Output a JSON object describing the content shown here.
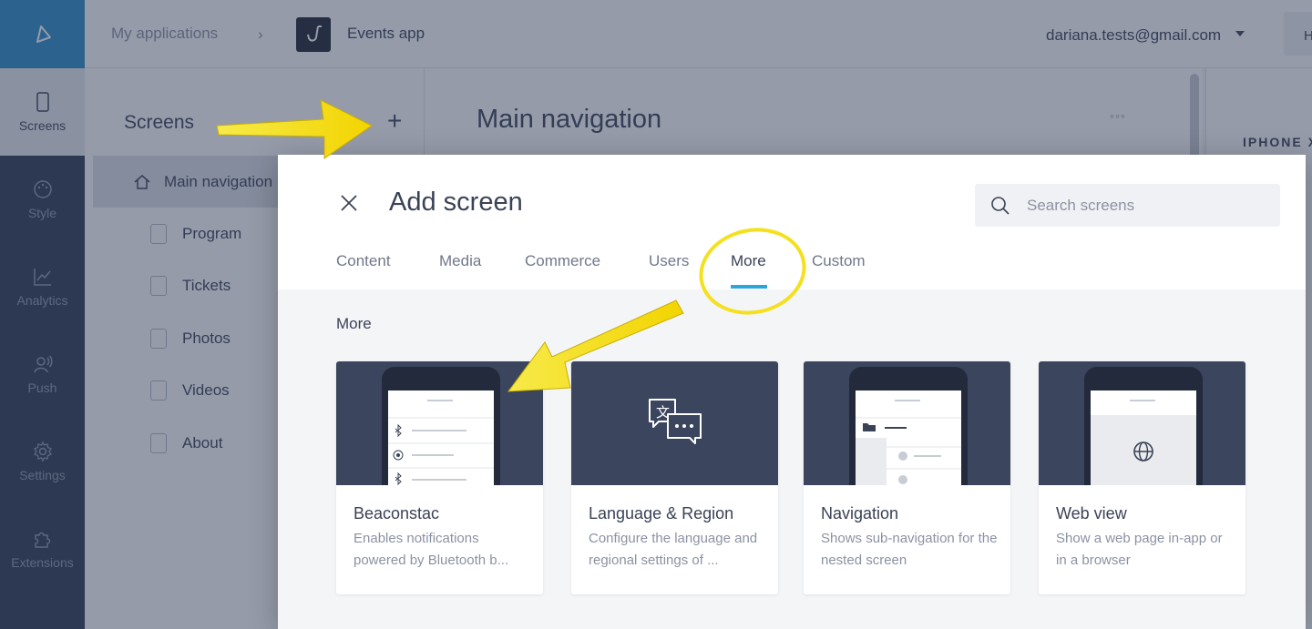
{
  "nav_rail": {
    "items": [
      {
        "label": "Screens",
        "icon": "phone-icon"
      },
      {
        "label": "Style",
        "icon": "palette-icon"
      },
      {
        "label": "Analytics",
        "icon": "chart-icon"
      },
      {
        "label": "Push",
        "icon": "push-icon"
      },
      {
        "label": "Settings",
        "icon": "gear-icon"
      },
      {
        "label": "Extensions",
        "icon": "puzzle-icon"
      }
    ]
  },
  "topbar": {
    "breadcrumb": "My applications",
    "app_name": "Events app",
    "user_email": "dariana.tests@gmail.com",
    "help_label": "H"
  },
  "screens_panel": {
    "title": "Screens",
    "items": [
      {
        "label": "Main navigation"
      },
      {
        "label": "Program"
      },
      {
        "label": "Tickets"
      },
      {
        "label": "Photos"
      },
      {
        "label": "Videos"
      },
      {
        "label": "About"
      }
    ]
  },
  "main": {
    "title": "Main navigation",
    "more_label": "◦◦◦"
  },
  "preview": {
    "device_label": "IPHONE X"
  },
  "modal": {
    "title": "Add screen",
    "search_placeholder": "Search screens",
    "tabs": [
      {
        "label": "Content"
      },
      {
        "label": "Media"
      },
      {
        "label": "Commerce"
      },
      {
        "label": "Users"
      },
      {
        "label": "More"
      },
      {
        "label": "Custom"
      }
    ],
    "active_tab": "More",
    "section_title": "More",
    "cards": [
      {
        "title": "Beaconstac",
        "description": "Enables notifications powered by Bluetooth b...",
        "icon": "bluetooth-icon"
      },
      {
        "title": "Language & Region",
        "description": "Configure the language and regional settings of ...",
        "icon": "translate-icon"
      },
      {
        "title": "Navigation",
        "description": "Shows sub-navigation for the nested screen",
        "icon": "folder-icon"
      },
      {
        "title": "Web view",
        "description": "Show a web page in-app or in a browser",
        "icon": "globe-icon"
      }
    ]
  },
  "colors": {
    "rail": "#2f3a52",
    "accent": "#2aa6d9",
    "logo_bg": "#2a8fc8",
    "card_image_bg": "#3b455e",
    "annotation": "#f5e01f"
  }
}
